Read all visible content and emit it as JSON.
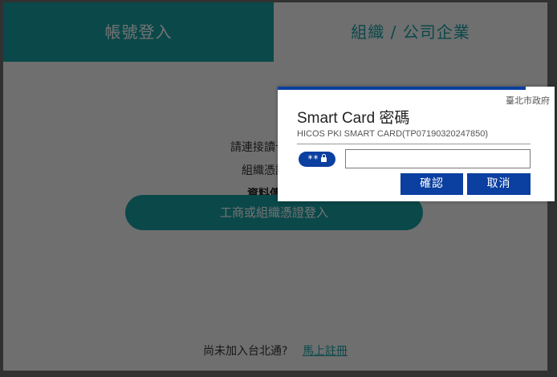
{
  "tabs": {
    "account": "帳號登入",
    "org": "組織 / 公司企業"
  },
  "instructions": {
    "line1": "請連接讀卡機，並",
    "line2": "組織憑證點擊",
    "line3": "資料傳輸中"
  },
  "cert_login_button": "工商或組織憑證登入",
  "signup": {
    "prompt": "尚未加入台北通?",
    "link": "馬上註冊"
  },
  "dialog": {
    "org": "臺北市政府",
    "title": "Smart Card 密碼",
    "subtitle": "HICOS PKI SMART CARD(TP07190320247850)",
    "pin_icon_text": "**",
    "pin_value": "",
    "ok_label": "確認",
    "cancel_label": "取消"
  },
  "colors": {
    "teal": "#1aa0a5",
    "dialog_blue": "#0b3fa0"
  }
}
